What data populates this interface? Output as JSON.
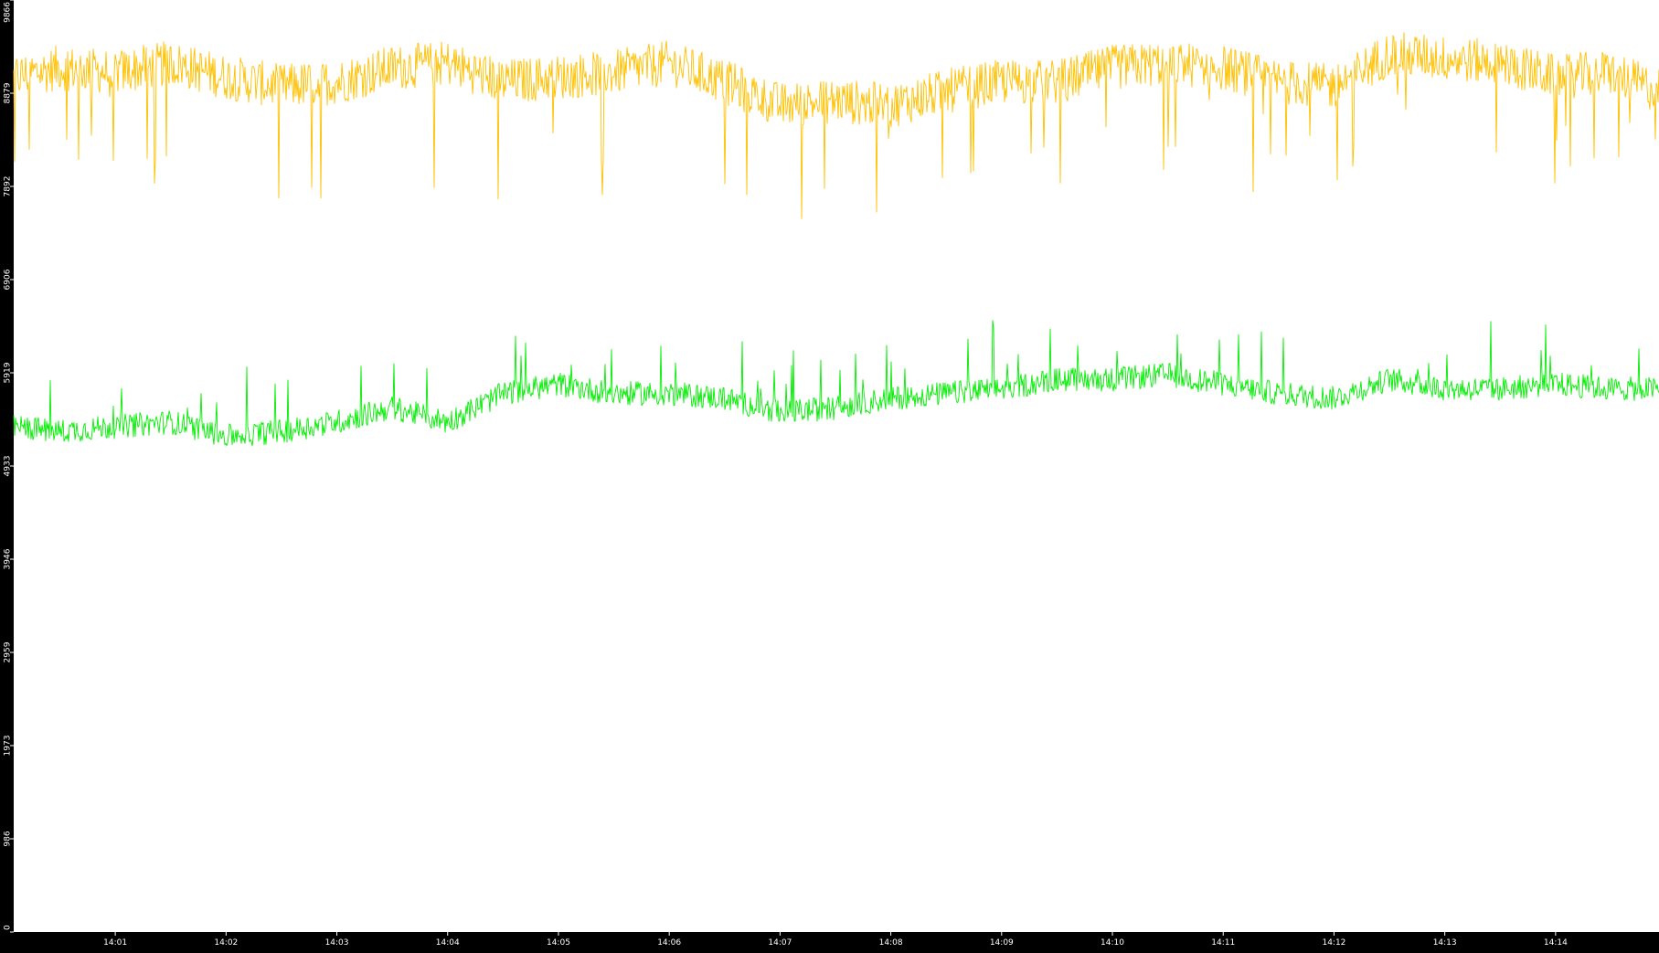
{
  "chart_data": {
    "type": "line",
    "title": "",
    "xlabel": "",
    "ylabel": "",
    "ylim": [
      0,
      9866
    ],
    "yticks": [
      "0",
      "986",
      "1973",
      "2959",
      "3946",
      "4933",
      "5919",
      "6906",
      "7892",
      "8879",
      "9866"
    ],
    "xticks": [
      "14:01",
      "14:02",
      "14:03",
      "14:04",
      "14:05",
      "14:06",
      "14:07",
      "14:08",
      "14:09",
      "14:10",
      "14:11",
      "14:12",
      "14:13",
      "14:14"
    ],
    "xlim": [
      "14:00:05",
      "14:14:56"
    ],
    "x_tick_times": [
      "14:01:00",
      "14:02:00",
      "14:03:00",
      "14:04:00",
      "14:05:00",
      "14:06:00",
      "14:07:00",
      "14:08:00",
      "14:09:00",
      "14:10:00",
      "14:11:00",
      "14:12:00",
      "14:13:00",
      "14:14:00"
    ],
    "background_color": "#ffffff",
    "axis_background_color": "#000000",
    "axis_text_color": "#ffffff",
    "grid": false,
    "legend": "none",
    "series": [
      {
        "color": "#ffc000",
        "times": [
          "14:00:05",
          "14:00:30",
          "14:01:00",
          "14:01:30",
          "14:02:00",
          "14:02:30",
          "14:03:00",
          "14:03:30",
          "14:04:00",
          "14:04:30",
          "14:05:00",
          "14:05:30",
          "14:06:00",
          "14:06:30",
          "14:07:00",
          "14:07:30",
          "14:08:00",
          "14:08:30",
          "14:09:00",
          "14:09:30",
          "14:10:00",
          "14:10:30",
          "14:11:00",
          "14:11:30",
          "14:12:00",
          "14:12:30",
          "14:13:00",
          "14:13:30",
          "14:14:00",
          "14:14:30",
          "14:14:56"
        ],
        "values": [
          9050,
          9150,
          9100,
          9200,
          9050,
          8950,
          9000,
          9150,
          9200,
          9000,
          9050,
          9100,
          9200,
          9000,
          8750,
          8800,
          8750,
          8900,
          9000,
          9000,
          9150,
          9200,
          9150,
          9000,
          8950,
          9300,
          9250,
          9200,
          9050,
          9100,
          8900
        ],
        "noise": 300
      },
      {
        "color": "#00ee00",
        "times": [
          "14:00:05",
          "14:00:30",
          "14:01:00",
          "14:01:30",
          "14:02:00",
          "14:02:30",
          "14:03:00",
          "14:03:30",
          "14:04:00",
          "14:04:30",
          "14:05:00",
          "14:05:30",
          "14:06:00",
          "14:06:30",
          "14:07:00",
          "14:07:30",
          "14:08:00",
          "14:08:30",
          "14:09:00",
          "14:09:30",
          "14:10:00",
          "14:10:30",
          "14:11:00",
          "14:11:30",
          "14:12:00",
          "14:12:30",
          "14:13:00",
          "14:13:30",
          "14:14:00",
          "14:14:30",
          "14:14:56"
        ],
        "values": [
          5350,
          5300,
          5350,
          5400,
          5250,
          5300,
          5400,
          5550,
          5400,
          5700,
          5800,
          5700,
          5700,
          5650,
          5500,
          5550,
          5650,
          5700,
          5750,
          5850,
          5850,
          5900,
          5800,
          5700,
          5650,
          5850,
          5750,
          5750,
          5800,
          5750,
          5750
        ],
        "noise": 160
      }
    ]
  }
}
